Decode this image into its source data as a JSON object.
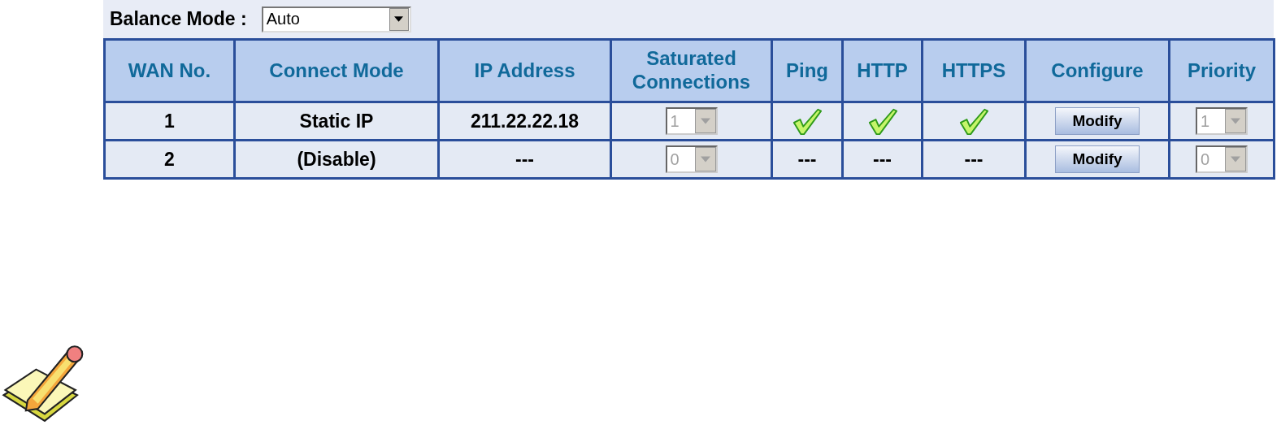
{
  "balance_mode": {
    "label": "Balance Mode :",
    "value": "Auto"
  },
  "table": {
    "columns": [
      "WAN No.",
      "Connect Mode",
      "IP Address",
      "Saturated Connections",
      "Ping",
      "HTTP",
      "HTTPS",
      "Configure",
      "Priority"
    ],
    "rows": [
      {
        "wan_no": "1",
        "connect_mode": "Static IP",
        "ip_address": "211.22.22.18",
        "saturated_connections": {
          "value": "1",
          "disabled": true
        },
        "ping": {
          "kind": "check"
        },
        "http": {
          "kind": "check"
        },
        "https": {
          "kind": "check"
        },
        "configure": "Modify",
        "priority": {
          "value": "1",
          "disabled": true
        }
      },
      {
        "wan_no": "2",
        "connect_mode": "(Disable)",
        "ip_address": "---",
        "saturated_connections": {
          "value": "0",
          "disabled": true
        },
        "ping": {
          "kind": "text",
          "text": "---"
        },
        "http": {
          "kind": "text",
          "text": "---"
        },
        "https": {
          "kind": "text",
          "text": "---"
        },
        "configure": "Modify",
        "priority": {
          "value": "0",
          "disabled": true
        }
      }
    ]
  }
}
